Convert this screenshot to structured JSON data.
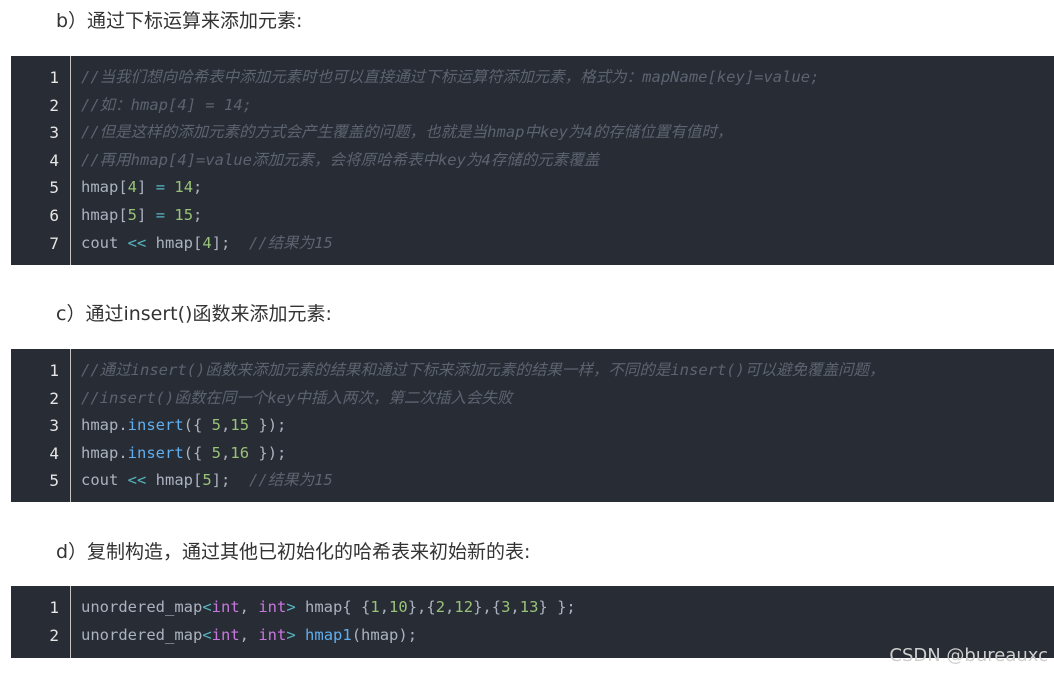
{
  "sections": [
    {
      "heading": "b）通过下标运算来添加元素:",
      "lines": [
        [
          {
            "t": "//当我们想向哈希表中添加元素时也可以直接通过下标运算符添加元素，格式为：mapName[key]=value;",
            "c": "cmt"
          }
        ],
        [
          {
            "t": "//如：hmap[4] = 14;",
            "c": "cmt"
          }
        ],
        [
          {
            "t": "//但是这样的添加元素的方式会产生覆盖的问题，也就是当hmap中key为4的存储位置有值时，",
            "c": "cmt"
          }
        ],
        [
          {
            "t": "//再用hmap[4]=value添加元素，会将原哈希表中key为4存储的元素覆盖",
            "c": "cmt"
          }
        ],
        [
          {
            "t": "hmap[",
            "c": ""
          },
          {
            "t": "4",
            "c": "num"
          },
          {
            "t": "] ",
            "c": ""
          },
          {
            "t": "=",
            "c": "op"
          },
          {
            "t": " ",
            "c": ""
          },
          {
            "t": "14",
            "c": "num"
          },
          {
            "t": ";",
            "c": ""
          }
        ],
        [
          {
            "t": "hmap[",
            "c": ""
          },
          {
            "t": "5",
            "c": "num"
          },
          {
            "t": "] ",
            "c": ""
          },
          {
            "t": "=",
            "c": "op"
          },
          {
            "t": " ",
            "c": ""
          },
          {
            "t": "15",
            "c": "num"
          },
          {
            "t": ";",
            "c": ""
          }
        ],
        [
          {
            "t": "cout ",
            "c": ""
          },
          {
            "t": "<<",
            "c": "op"
          },
          {
            "t": " hmap[",
            "c": ""
          },
          {
            "t": "4",
            "c": "num"
          },
          {
            "t": "];  ",
            "c": ""
          },
          {
            "t": "//结果为15",
            "c": "cmt"
          }
        ]
      ]
    },
    {
      "heading": "c）通过insert()函数来添加元素:",
      "lines": [
        [
          {
            "t": "//通过insert()函数来添加元素的结果和通过下标来添加元素的结果一样，不同的是insert()可以避免覆盖问题，",
            "c": "cmt"
          }
        ],
        [
          {
            "t": "//insert()函数在同一个key中插入两次，第二次插入会失败",
            "c": "cmt"
          }
        ],
        [
          {
            "t": "hmap.",
            "c": ""
          },
          {
            "t": "insert",
            "c": "fn"
          },
          {
            "t": "({ ",
            "c": ""
          },
          {
            "t": "5",
            "c": "num"
          },
          {
            "t": ",",
            "c": ""
          },
          {
            "t": "15",
            "c": "num"
          },
          {
            "t": " });",
            "c": ""
          }
        ],
        [
          {
            "t": "hmap.",
            "c": ""
          },
          {
            "t": "insert",
            "c": "fn"
          },
          {
            "t": "({ ",
            "c": ""
          },
          {
            "t": "5",
            "c": "num"
          },
          {
            "t": ",",
            "c": ""
          },
          {
            "t": "16",
            "c": "num"
          },
          {
            "t": " });",
            "c": ""
          }
        ],
        [
          {
            "t": "cout ",
            "c": ""
          },
          {
            "t": "<<",
            "c": "op"
          },
          {
            "t": " hmap[",
            "c": ""
          },
          {
            "t": "5",
            "c": "num"
          },
          {
            "t": "];  ",
            "c": ""
          },
          {
            "t": "//结果为15",
            "c": "cmt"
          }
        ]
      ]
    },
    {
      "heading": "d）复制构造，通过其他已初始化的哈希表来初始新的表:",
      "lines": [
        [
          {
            "t": "unordered_map",
            "c": ""
          },
          {
            "t": "<",
            "c": "op"
          },
          {
            "t": "int",
            "c": "ty"
          },
          {
            "t": ", ",
            "c": ""
          },
          {
            "t": "int",
            "c": "ty"
          },
          {
            "t": ">",
            "c": "op"
          },
          {
            "t": " hmap{ {",
            "c": ""
          },
          {
            "t": "1",
            "c": "num"
          },
          {
            "t": ",",
            "c": ""
          },
          {
            "t": "10",
            "c": "num"
          },
          {
            "t": "},{",
            "c": ""
          },
          {
            "t": "2",
            "c": "num"
          },
          {
            "t": ",",
            "c": ""
          },
          {
            "t": "12",
            "c": "num"
          },
          {
            "t": "},{",
            "c": ""
          },
          {
            "t": "3",
            "c": "num"
          },
          {
            "t": ",",
            "c": ""
          },
          {
            "t": "13",
            "c": "num"
          },
          {
            "t": "} };",
            "c": ""
          }
        ],
        [
          {
            "t": "unordered_map",
            "c": ""
          },
          {
            "t": "<",
            "c": "op"
          },
          {
            "t": "int",
            "c": "ty"
          },
          {
            "t": ", ",
            "c": ""
          },
          {
            "t": "int",
            "c": "ty"
          },
          {
            "t": ">",
            "c": "op"
          },
          {
            "t": " ",
            "c": ""
          },
          {
            "t": "hmap1",
            "c": "fn"
          },
          {
            "t": "(hmap);",
            "c": ""
          }
        ]
      ]
    }
  ],
  "watermark": "CSDN @bureauxc"
}
